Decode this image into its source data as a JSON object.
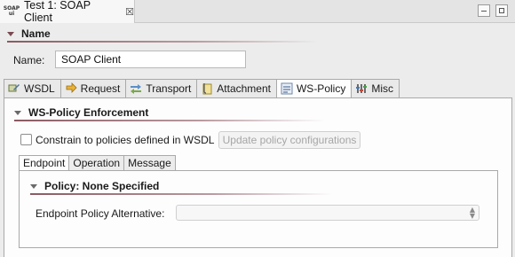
{
  "editor": {
    "tab_title": "Test 1: SOAP Client",
    "icon_text_top": "SOAP",
    "icon_text_bottom": "ui",
    "close_glyph": "☒"
  },
  "name_section": {
    "header": "Name",
    "field_label": "Name:",
    "field_value": "SOAP Client"
  },
  "tabs": [
    {
      "label": "WSDL",
      "icon": "wsdl-icon"
    },
    {
      "label": "Request",
      "icon": "request-icon"
    },
    {
      "label": "Transport",
      "icon": "transport-icon"
    },
    {
      "label": "Attachment",
      "icon": "attachment-icon"
    },
    {
      "label": "WS-Policy",
      "icon": "ws-policy-icon",
      "active": true
    },
    {
      "label": "Misc",
      "icon": "misc-icon"
    }
  ],
  "ws_policy": {
    "header": "WS-Policy Enforcement",
    "checkbox_label": "Constrain to policies defined in WSDL",
    "checkbox_checked": false,
    "update_button": "Update policy configurations",
    "inner_tabs": [
      "Endpoint",
      "Operation",
      "Message"
    ],
    "policy_header": "Policy: None Specified",
    "alternative_label": "Endpoint Policy Alternative:",
    "alternative_value": ""
  },
  "colors": {
    "section_rule": "#8a5a62",
    "background": "#ececec",
    "panel": "#fdfdfd"
  }
}
